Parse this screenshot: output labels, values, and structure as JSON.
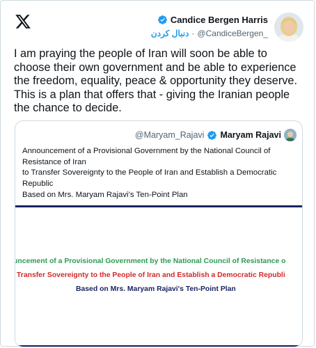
{
  "author": {
    "name": "Candice Bergen Harris",
    "handle": "@CandiceBergen_",
    "separator": "·",
    "follow_label": "دنبال کردن"
  },
  "tweet": {
    "text": "I am praying the people of Iran will soon be able to choose their own government and be able to experience the freedom, equality, peace & opportunity they deserve. This is a plan that offers that - giving the Iranian people the chance to decide."
  },
  "quoted": {
    "name": "Maryam Rajavi",
    "handle": "@Maryam_Rajavi",
    "lines": [
      "Announcement of a Provisional Government by the National Council of Resistance of Iran",
      "to Transfer Sovereignty to the People of Iran and Establish a Democratic Republic",
      "Based on Mrs. Maryam Rajavi’s Ten-Point Plan"
    ],
    "image_lines": [
      "uncement of a Provisional Government by the National Council of Resistance o",
      "Transfer Sovereignty to the People of Iran and Establish a Democratic Republi",
      "Based on Mrs. Maryam Rajavi's Ten-Point Plan"
    ]
  },
  "colors": {
    "accent": "#1d9bf0",
    "text": "#0f1419",
    "muted": "#536471",
    "image_green": "#2f9a54",
    "image_red": "#d22a2a",
    "image_navy": "#1c2661"
  },
  "icons": [
    "x-logo-icon",
    "verified-badge-icon",
    "avatar"
  ]
}
